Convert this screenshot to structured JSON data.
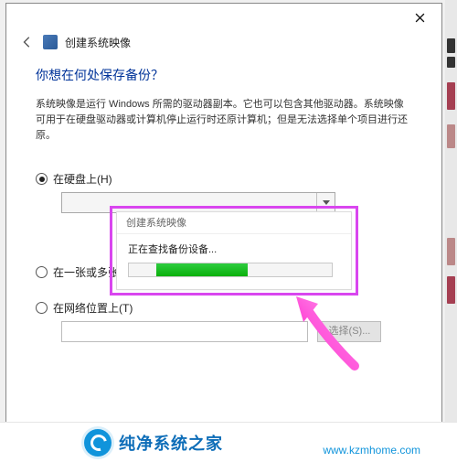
{
  "window": {
    "app_title": "创建系统映像",
    "close_tooltip": "关闭"
  },
  "page": {
    "heading": "你想在何处保存备份？",
    "description": "系统映像是运行 Windows 所需的驱动器副本。它也可以包含其他驱动器。系统映像可用于在硬盘驱动器或计算机停止运行时还原计算机；但是无法选择单个项目进行还原。"
  },
  "options": {
    "hard_disk": {
      "label": "在硬盘上(H)",
      "checked": true
    },
    "dvd": {
      "label": "在一张或多张 DVD 上(D)",
      "checked": false
    },
    "network": {
      "label": "在网络位置上(T)",
      "checked": false,
      "browse_label": "选择(S)..."
    }
  },
  "progress_dialog": {
    "title": "创建系统映像",
    "message": "正在查找备份设备...",
    "percent": 45
  },
  "watermark": {
    "site_name": "纯净系统之家",
    "url": "www.kzmhome.com"
  }
}
